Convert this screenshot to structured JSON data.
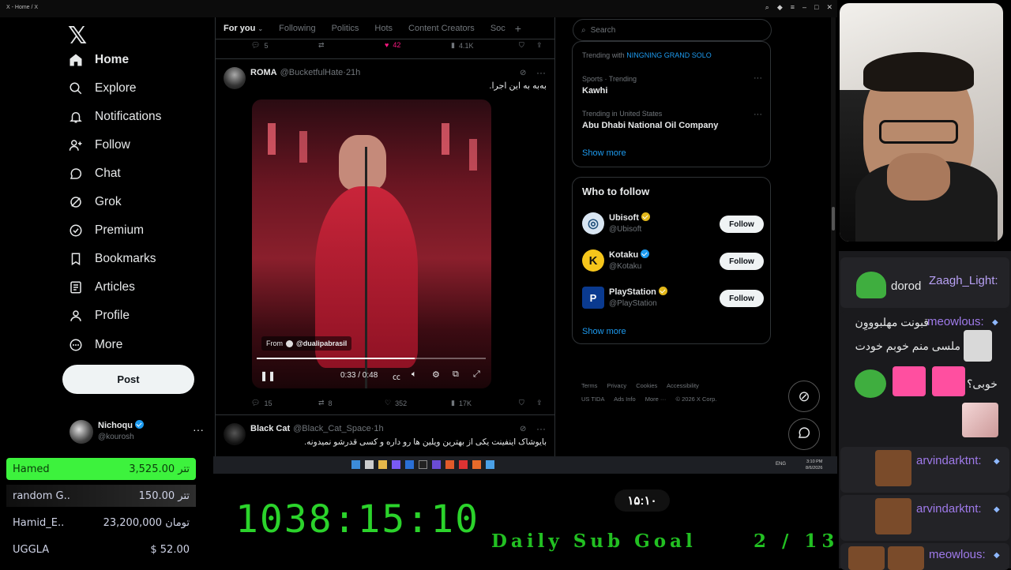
{
  "window": {
    "title": "X - Home / X"
  },
  "nav": {
    "items": [
      {
        "label": "Home",
        "icon": "home-icon"
      },
      {
        "label": "Explore",
        "icon": "search-icon"
      },
      {
        "label": "Notifications",
        "icon": "bell-icon"
      },
      {
        "label": "Follow",
        "icon": "add-person-icon"
      },
      {
        "label": "Chat",
        "icon": "chat-icon"
      },
      {
        "label": "Grok",
        "icon": "grok-icon"
      },
      {
        "label": "Premium",
        "icon": "premium-icon"
      },
      {
        "label": "Bookmarks",
        "icon": "bookmark-icon"
      },
      {
        "label": "Articles",
        "icon": "article-icon"
      },
      {
        "label": "Profile",
        "icon": "person-icon"
      },
      {
        "label": "More",
        "icon": "more-circle-icon"
      }
    ],
    "post_label": "Post",
    "account": {
      "name": "Nichoqu",
      "handle": "@kourosh"
    }
  },
  "feed": {
    "tabs": [
      "For you",
      "Following",
      "Politics",
      "Hots",
      "Content Creators",
      "Soc"
    ],
    "prev_actions": {
      "replies": "5",
      "likes": "42",
      "views": "4.1K"
    },
    "tweet1": {
      "name": "ROMA",
      "handle": "@BucketfulHate",
      "time": "21h",
      "text": "به‌به به این اجرا.",
      "video_from": "From",
      "video_source": "@dualipabrasil",
      "video_time": "0:33 / 0:48",
      "replies": "15",
      "reposts": "8",
      "likes": "352",
      "views": "17K"
    },
    "tweet2": {
      "name": "Black Cat",
      "handle": "@Black_Cat_Space",
      "time": "1h",
      "text": "بایوشاک اینفینت یکی از بهترین ویلین ها رو داره و کسی قدرشو نمیدونه."
    }
  },
  "sidebar": {
    "search_placeholder": "Search",
    "trending_with_prefix": "Trending with",
    "trending_with_link": "NINGNING GRAND SOLO",
    "trends": [
      {
        "meta": "Sports · Trending",
        "name": "Kawhi"
      },
      {
        "meta": "Trending in United States",
        "name": "Abu Dhabi National Oil Company"
      }
    ],
    "show_more": "Show more",
    "who_to_follow_title": "Who to follow",
    "follow_suggestions": [
      {
        "name": "Ubisoft",
        "handle": "@Ubisoft",
        "button": "Follow"
      },
      {
        "name": "Kotaku",
        "handle": "@Kotaku",
        "button": "Follow"
      },
      {
        "name": "PlayStation",
        "handle": "@PlayStation",
        "button": "Follow"
      }
    ],
    "show_more_follow": "Show more",
    "footer": [
      "Terms",
      "Privacy",
      "Cookies",
      "Accessibility",
      "US TIDA",
      "Ads Info",
      "More ···",
      "© 2026 X Corp."
    ]
  },
  "taskbar": {
    "lang": "ENG",
    "time": "3:10 PM",
    "date": "8/6/2026"
  },
  "chat": {
    "messages": [
      {
        "user": "Zaagh_Light:",
        "text": "dorod"
      },
      {
        "user": "meowlous:",
        "line1": "قبونت مهلبوووِن",
        "line2": "ملسی منم خوبم خودت",
        "line3": "خوبی؟"
      },
      {
        "user": "arvindarktnt:"
      },
      {
        "user": "arvindarktnt:"
      },
      {
        "user": "meowlous:"
      }
    ]
  },
  "donations": [
    {
      "name": "Hamed",
      "amount": "3,525.00 تتر"
    },
    {
      "name": "random G..",
      "amount": "150.00 تتر"
    },
    {
      "name": "Hamid_E..",
      "amount": "23,200,000 تومان"
    },
    {
      "name": "UGGLA",
      "amount": "$ 52.00"
    }
  ],
  "overlay": {
    "timer": "1038:15:10",
    "clock": "۱۵:۱۰",
    "goal_label": "Daily Sub Goal",
    "goal_count": "2 / 13"
  },
  "colors": {
    "accent": "#1d9bf0",
    "like": "#f91880",
    "timer": "#2bd32b",
    "chat_user": "#9f7aea"
  }
}
